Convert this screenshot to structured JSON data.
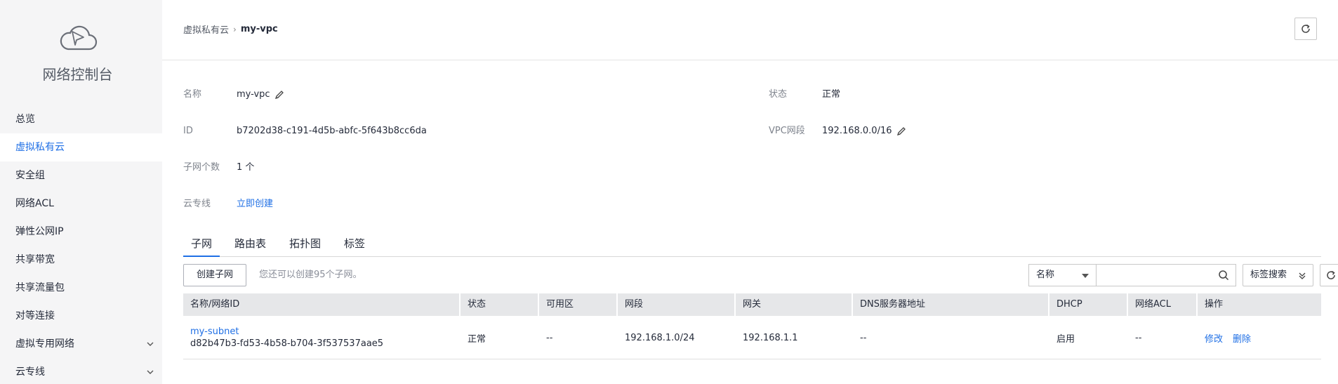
{
  "sidebar": {
    "title": "网络控制台",
    "items": [
      {
        "label": "总览"
      },
      {
        "label": "虚拟私有云"
      },
      {
        "label": "安全组"
      },
      {
        "label": "网络ACL"
      },
      {
        "label": "弹性公网IP"
      },
      {
        "label": "共享带宽"
      },
      {
        "label": "共享流量包"
      },
      {
        "label": "对等连接"
      },
      {
        "label": "虚拟专用网络"
      },
      {
        "label": "云专线"
      }
    ],
    "active_index": 1
  },
  "breadcrumb": {
    "parent": "虚拟私有云",
    "separator": "›",
    "current": "my-vpc"
  },
  "info": {
    "name_label": "名称",
    "name_value": "my-vpc",
    "status_label": "状态",
    "status_value": "正常",
    "id_label": "ID",
    "id_value": "b7202d38-c191-4d5b-abfc-5f643b8cc6da",
    "cidr_label": "VPC网段",
    "cidr_value": "192.168.0.0/16",
    "subnet_count_label": "子网个数",
    "subnet_count_value": "1 个",
    "dc_label": "云专线",
    "dc_value": "立即创建"
  },
  "tabs": [
    {
      "label": "子网"
    },
    {
      "label": "路由表"
    },
    {
      "label": "拓扑图"
    },
    {
      "label": "标签"
    }
  ],
  "toolbar": {
    "create_label": "创建子网",
    "hint": "您还可以创建95个子网。",
    "filter_selected": "名称",
    "search_value": "",
    "tag_search_label": "标签搜索"
  },
  "table": {
    "columns": [
      "名称/网络ID",
      "状态",
      "可用区",
      "网段",
      "网关",
      "DNS服务器地址",
      "DHCP",
      "网络ACL",
      "操作"
    ],
    "rows": [
      {
        "name": "my-subnet",
        "id": "d82b47b3-fd53-4b58-b704-3f537537aae5",
        "status": "正常",
        "az": "--",
        "cidr": "192.168.1.0/24",
        "gateway": "192.168.1.1",
        "dns": "--",
        "dhcp": "启用",
        "acl": "--",
        "op_modify": "修改",
        "op_delete": "删除"
      }
    ]
  },
  "colors": {
    "accent": "#1f6fe5",
    "sidebar_bg": "#f5f5f6",
    "table_header_bg": "#e6e7e9"
  }
}
